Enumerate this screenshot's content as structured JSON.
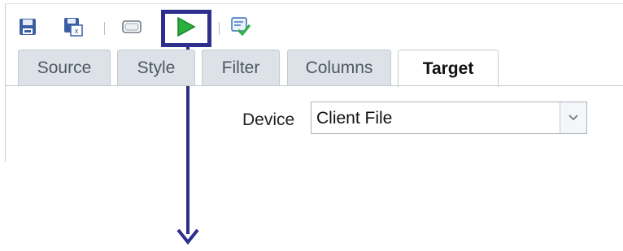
{
  "tabs": [
    {
      "label": "Source"
    },
    {
      "label": "Style"
    },
    {
      "label": "Filter"
    },
    {
      "label": "Columns"
    },
    {
      "label": "Target",
      "active": true
    }
  ],
  "target": {
    "device_label": "Device",
    "device_value": "Client File"
  },
  "toolbar": {
    "icons": [
      "save-icon",
      "save-as-icon",
      "preview-icon",
      "run-icon",
      "validate-icon"
    ]
  },
  "colors": {
    "highlight": "#2e2f8c",
    "run_green": "#2bb13f",
    "tab_inactive": "#dde2e8"
  }
}
